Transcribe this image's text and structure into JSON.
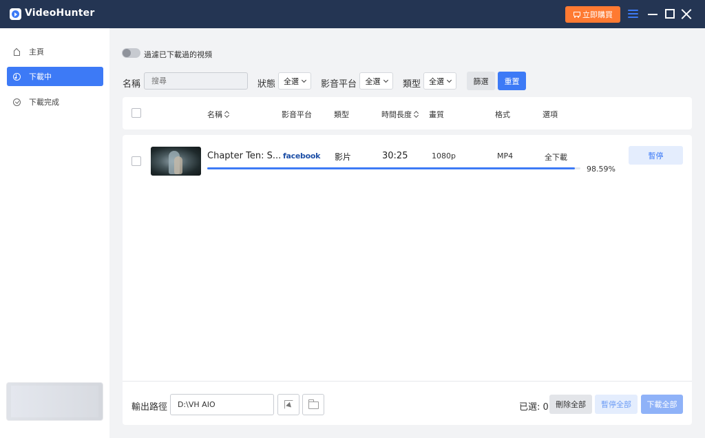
{
  "titlebar": {
    "app_title": "VideoHunter",
    "buy_label": "立即購買",
    "accent_color": "#3d7af6",
    "buy_color": "#ff7a32"
  },
  "sidebar": {
    "items": [
      {
        "label": "主頁",
        "icon": "home-icon"
      },
      {
        "label": "下載中",
        "icon": "download-icon",
        "active": true
      },
      {
        "label": "下載完成",
        "icon": "check-circle-icon"
      }
    ]
  },
  "toolbar": {
    "toggle_label": "過濾已下載過的視頻",
    "name_label": "名稱",
    "search_placeholder": "搜尋",
    "status_label": "狀態",
    "status_value": "全選",
    "platform_label": "影音平台",
    "platform_value": "全選",
    "type_label": "類型",
    "type_value": "全選",
    "filter_button": "篩選",
    "reset_button": "重置"
  },
  "table": {
    "headers": {
      "name": "名稱",
      "platform": "影音平台",
      "type": "類型",
      "duration": "時間長度",
      "quality": "畫質",
      "format": "格式",
      "options": "選項"
    },
    "rows": [
      {
        "title": "Chapter Ten: S...",
        "platform": "facebook",
        "type": "影片",
        "duration": "30:25",
        "quality": "1080p",
        "format": "MP4",
        "option": "全下載",
        "progress_text": "98.59%",
        "progress": 0.9859,
        "action": "暫停"
      }
    ]
  },
  "footer": {
    "output_label": "輸出路徑",
    "output_path": "D:\\VH AIO",
    "selected_label": "已選: 0",
    "delete_all": "刪除全部",
    "pause_all": "暫停全部",
    "download_all": "下載全部"
  }
}
